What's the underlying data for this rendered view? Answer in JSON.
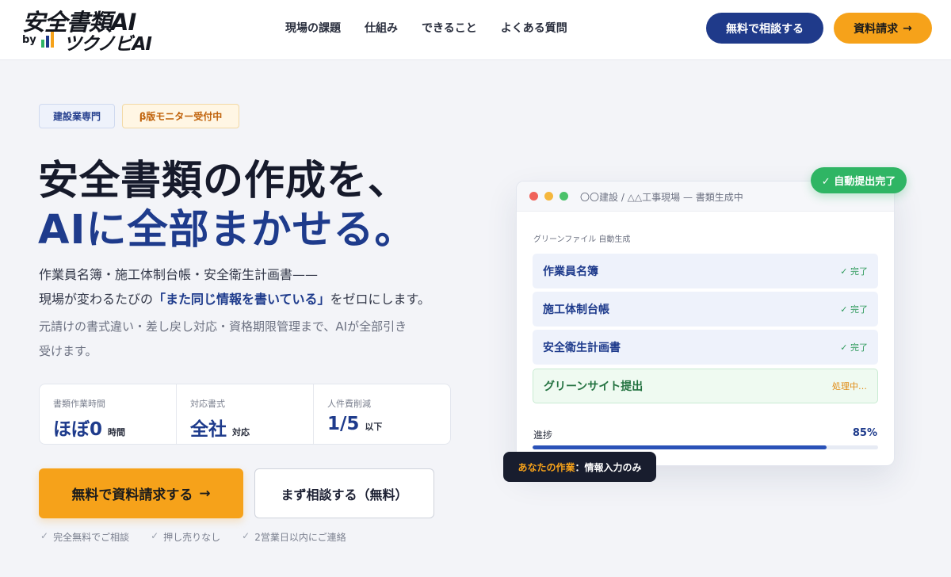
{
  "header": {
    "logo_main": "安全書類AI",
    "logo_by": "by",
    "logo_sub": "ツクノビAI",
    "nav": [
      "現場の課題",
      "仕組み",
      "できること",
      "よくある質問"
    ],
    "consult_label": "無料で相談する",
    "docs_label": "資料請求",
    "docs_arrow": "→"
  },
  "hero": {
    "tags": [
      "建設業専門",
      "β版モニター受付中"
    ],
    "headline_1": "安全書類の作成を、",
    "headline_2": "AIに全部まかせる。",
    "lead_1": "作業員名簿・施工体制台帳・安全衛生計画書——",
    "lead_2_pre": "現場が変わるたびの",
    "lead_2_em": "「また同じ情報を書いている」",
    "lead_2_post": "をゼロにします。",
    "sub_1": "元請けの書式違い・差し戻し対応・資格期限管理まで、AIが全部引き",
    "sub_2": "受けます。"
  },
  "stats": [
    {
      "label": "書類作業時間",
      "value": "ほぼ0",
      "unit": "時間"
    },
    {
      "label": "対応書式",
      "value": "全社",
      "unit": "対応"
    },
    {
      "label": "人件費削減",
      "value": "1/5",
      "unit": "以下"
    }
  ],
  "cta": {
    "main_label": "無料で資料請求する",
    "main_arrow": "→",
    "secondary_label": "まず相談する（無料）"
  },
  "notes": [
    "完全無料でご相談",
    "押し売りなし",
    "2営業日以内にご連絡"
  ],
  "note_check": "✓",
  "mockup": {
    "window_title": "〇〇建設 / △△工事現場 — 書類生成中",
    "section_label": "グリーンファイル 自動生成",
    "rows": [
      {
        "name": "作業員名簿",
        "status": "✓ 完了"
      },
      {
        "name": "施工体制台帳",
        "status": "✓ 完了"
      },
      {
        "name": "安全衛生計画書",
        "status": "✓ 完了"
      },
      {
        "name": "グリーンサイト提出",
        "status": "処理中…"
      }
    ],
    "progress_label": "進捗",
    "progress_value": "85%",
    "progress_fraction": 0.85,
    "badge_done": "✓ 自動提出完了",
    "task_badge_hl": "あなたの作業",
    "task_badge_rest": "：情報入力のみ"
  },
  "colors": {
    "brand_navy": "#1f3a8a",
    "accent_orange": "#f6a21a",
    "success_green": "#2fb564"
  }
}
